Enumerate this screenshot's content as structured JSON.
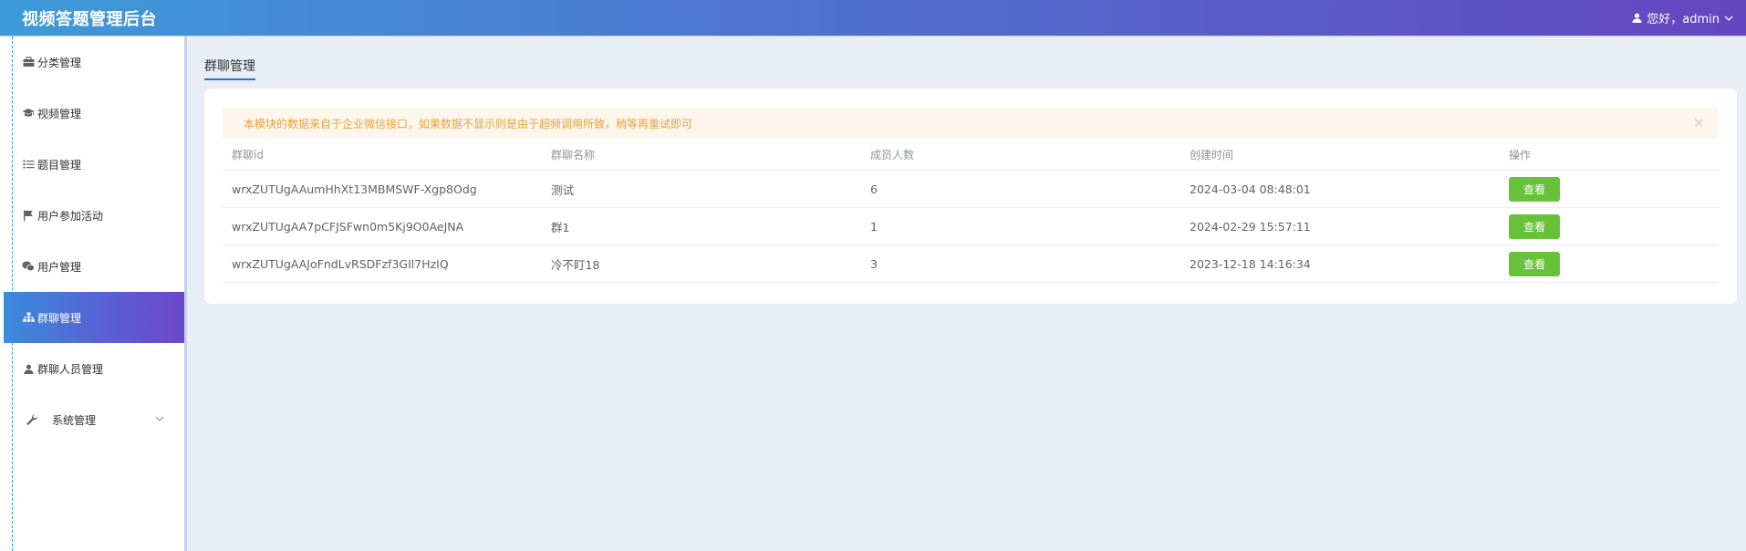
{
  "header": {
    "title": "视频答题管理后台",
    "user_greeting": "您好，admin"
  },
  "sidebar": {
    "items": [
      {
        "label": "分类管理",
        "icon": "briefcase-icon"
      },
      {
        "label": "视频管理",
        "icon": "graduation-cap-icon"
      },
      {
        "label": "题目管理",
        "icon": "list-icon"
      },
      {
        "label": "用户参加活动",
        "icon": "flag-icon"
      },
      {
        "label": "用户管理",
        "icon": "wechat-icon"
      },
      {
        "label": "群聊管理",
        "icon": "sitemap-icon",
        "active": true
      },
      {
        "label": "群聊人员管理",
        "icon": "user-icon"
      },
      {
        "label": "系统管理",
        "icon": "wrench-icon",
        "expandable": true
      }
    ]
  },
  "main": {
    "page_title": "群聊管理",
    "alert": {
      "text": "本模块的数据来自于企业微信接口，如果数据不显示则是由于超频调用所致，稍等再重试即可",
      "close": "×"
    },
    "table": {
      "columns": [
        "群聊id",
        "群聊名称",
        "成员人数",
        "创建时间",
        "操作"
      ],
      "rows": [
        {
          "id": "wrxZUTUgAAumHhXt13MBMSWF-Xgp8Odg",
          "name": "测试",
          "members": "6",
          "created": "2024-03-04 08:48:01",
          "action": "查看"
        },
        {
          "id": "wrxZUTUgAA7pCFJSFwn0m5Kj9O0AeJNA",
          "name": "群1",
          "members": "1",
          "created": "2024-02-29 15:57:11",
          "action": "查看"
        },
        {
          "id": "wrxZUTUgAAJoFndLvRSDFzf3GIl7HzIQ",
          "name": "冷不盯18",
          "members": "3",
          "created": "2023-12-18 14:16:34",
          "action": "查看"
        }
      ]
    }
  },
  "colors": {
    "accent": "#2c6fd1",
    "button": "#67c23a",
    "alert_bg": "#fdf6ec",
    "alert_text": "#e6a23c"
  }
}
